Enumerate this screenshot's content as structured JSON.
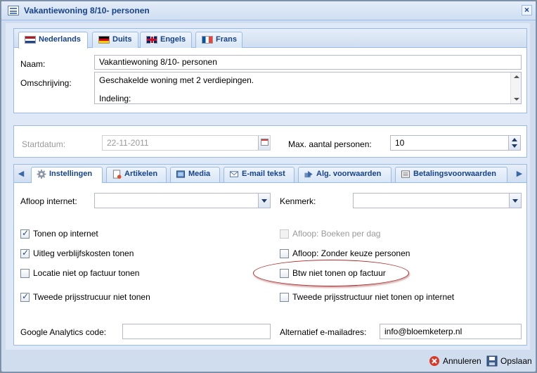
{
  "window": {
    "title": "Vakantiewoning 8/10- personen",
    "close_glyph": "×"
  },
  "language_tabs": [
    {
      "label": "Nederlands",
      "flag": "flag-nl"
    },
    {
      "label": "Duits",
      "flag": "flag-de"
    },
    {
      "label": "Engels",
      "flag": "flag-en"
    },
    {
      "label": "Frans",
      "flag": "flag-fr"
    }
  ],
  "general": {
    "naam_label": "Naam:",
    "naam_value": "Vakantiewoning 8/10- personen",
    "omschrijving_label": "Omschrijving:",
    "omschrijving_lines": [
      "Geschakelde woning met 2 verdiepingen.",
      "Indeling:"
    ]
  },
  "dates": {
    "startdatum_label": "Startdatum:",
    "startdatum_value": "22-11-2011",
    "max_personen_label": "Max. aantal personen:",
    "max_personen_value": "10"
  },
  "settings_tabs": [
    {
      "label": "Instellingen",
      "icon": "gear-icon"
    },
    {
      "label": "Artikelen",
      "icon": "document-icon"
    },
    {
      "label": "Media",
      "icon": "image-icon"
    },
    {
      "label": "E-mail tekst",
      "icon": "mail-icon"
    },
    {
      "label": "Alg. voorwaarden",
      "icon": "terms-icon"
    },
    {
      "label": "Betalingsvoorwaarden",
      "icon": "payment-icon"
    }
  ],
  "settings": {
    "afloop_internet_label": "Afloop internet:",
    "afloop_internet_value": "",
    "kenmerk_label": "Kenmerk:",
    "kenmerk_value": "",
    "checkboxes_left": [
      {
        "label": "Tonen op internet",
        "checked": true
      },
      {
        "label": "Uitleg verblijfskosten tonen",
        "checked": true
      },
      {
        "label": "Locatie niet op factuur tonen",
        "checked": false
      },
      {
        "label": "Tweede prijsstrucuur niet tonen",
        "checked": true
      }
    ],
    "checkboxes_right": [
      {
        "label": "Afloop: Boeken per dag",
        "checked": false,
        "disabled": true
      },
      {
        "label": "Afloop: Zonder keuze personen",
        "checked": false,
        "disabled": false
      },
      {
        "label": "Btw niet tonen op factuur",
        "checked": false,
        "disabled": false
      },
      {
        "label": "Tweede prijsstructuur niet tonen op internet",
        "checked": false,
        "disabled": false
      }
    ],
    "ga_label": "Google Analytics code:",
    "ga_value": "",
    "alt_email_label": "Alternatief e-mailadres:",
    "alt_email_value": "info@bloemketerp.nl"
  },
  "footer": {
    "cancel_label": "Annuleren",
    "save_label": "Opslaan"
  },
  "colors": {
    "title_text": "#15428b",
    "highlight_ellipse": "#b02a2a"
  }
}
